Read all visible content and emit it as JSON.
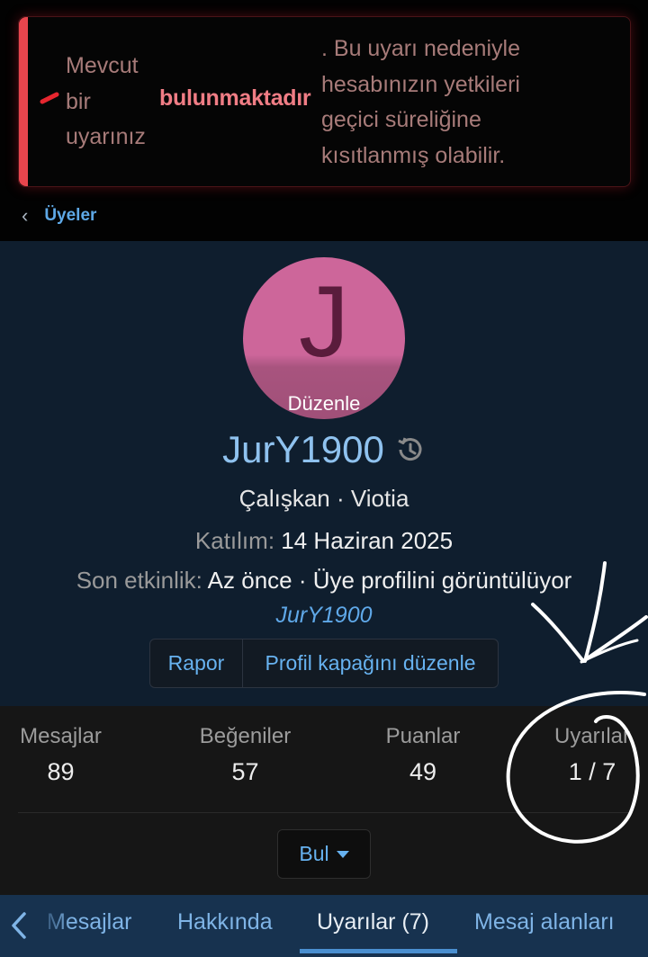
{
  "warning": {
    "col1": [
      "Mevcut",
      "bir",
      "uyarınız"
    ],
    "strong": "bulunmaktadır",
    "col3": [
      ". Bu uyarı nedeniyle",
      "hesabınızın yetkileri",
      "geçici süreliğine",
      "kısıtlanmış olabilir."
    ]
  },
  "breadcrumb": {
    "label": "Üyeler"
  },
  "profile": {
    "avatar_letter": "J",
    "avatar_edit": "Düzenle",
    "username": "JurY1900",
    "title_line": "Çalışkan · Viotia",
    "joined_label": "Katılım:",
    "joined_value": "14 Haziran 2025",
    "activity_label": "Son etkinlik:",
    "activity_value": "Az önce · Üye profilini görüntülüyor",
    "activity_link": "JurY1900",
    "buttons": {
      "report": "Rapor",
      "edit_cover": "Profil kapağını düzenle"
    }
  },
  "stats": [
    {
      "label": "Mesajlar",
      "value": "89"
    },
    {
      "label": "Beğeniler",
      "value": "57"
    },
    {
      "label": "Puanlar",
      "value": "49"
    },
    {
      "label": "Uyarılar",
      "value": "1 / 7"
    }
  ],
  "find_button": "Bul",
  "tabs": [
    "Mesajlar",
    "Hakkında",
    "Uyarılar (7)",
    "Mesaj alanları"
  ],
  "colors": {
    "warning_accent": "#e8454d",
    "avatar_bg": "#cd669a",
    "link": "#67b2f0",
    "profile_bg": "#0f1e2e",
    "tabs_bg": "#17324f"
  }
}
